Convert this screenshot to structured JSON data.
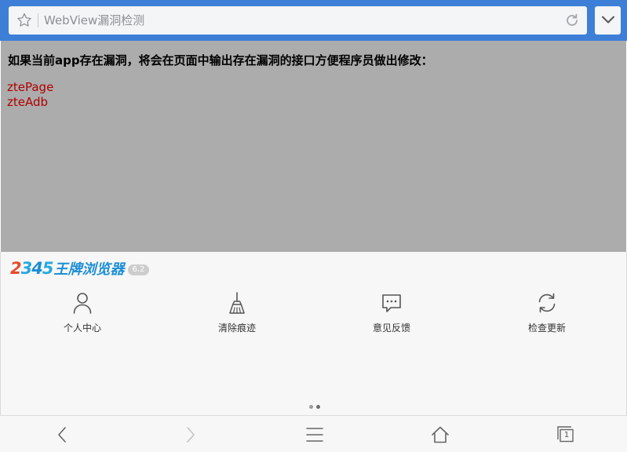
{
  "address_bar": {
    "title": "WebView漏洞检测",
    "icons": [
      "star-icon",
      "refresh-icon",
      "chevron-down-icon"
    ]
  },
  "content": {
    "heading": "如果当前app存在漏洞，将会在页面中输出存在漏洞的接口方便程序员做出修改：",
    "vulnerable_interfaces": [
      "ztePage",
      "zteAdb"
    ],
    "colors": {
      "background": "#acacac",
      "interface_text": "#b00000"
    }
  },
  "menu_panel": {
    "brand": {
      "digits": [
        "2",
        "3",
        "4",
        "5"
      ],
      "name": "王牌浏览器",
      "version": "6.2"
    },
    "items": [
      {
        "label": "个人中心",
        "icon": "person-icon"
      },
      {
        "label": "清除痕迹",
        "icon": "broom-icon"
      },
      {
        "label": "意见反馈",
        "icon": "chat-bubble-icon"
      },
      {
        "label": "检查更新",
        "icon": "sync-icon"
      }
    ],
    "page_indicator": {
      "pages": 2,
      "current": 2
    }
  },
  "bottom_nav": {
    "items": [
      "back-icon",
      "forward-icon",
      "menu-icon",
      "home-icon",
      "tabs-icon"
    ],
    "tab_count": "1"
  },
  "colors": {
    "top_bar": "#3d7fd6",
    "panel": "#f7f7f7",
    "brand": "#1d8fd6"
  }
}
